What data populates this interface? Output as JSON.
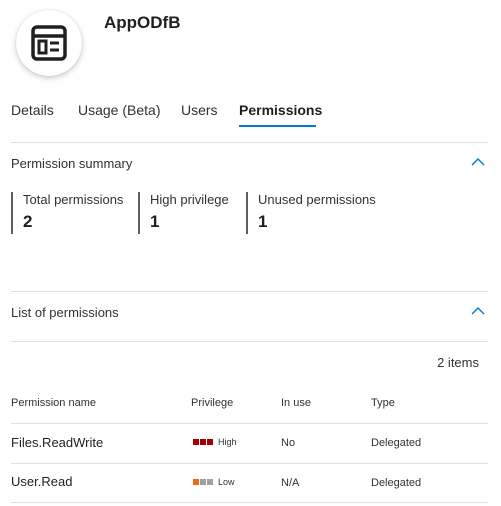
{
  "app": {
    "title": "AppODfB",
    "logo_icon": "app-window-icon"
  },
  "tabs": [
    {
      "label": "Details",
      "active": false
    },
    {
      "label": "Usage (Beta)",
      "active": false
    },
    {
      "label": "Users",
      "active": false
    },
    {
      "label": "Permissions",
      "active": true
    }
  ],
  "summary": {
    "title": "Permission summary",
    "stats": [
      {
        "label": "Total permissions",
        "value": "2"
      },
      {
        "label": "High privilege",
        "value": "1"
      },
      {
        "label": "Unused permissions",
        "value": "1"
      }
    ]
  },
  "list": {
    "title": "List of permissions",
    "count_text": "2 items",
    "columns": [
      "Permission name",
      "Privilege",
      "In use",
      "Type"
    ],
    "rows": [
      {
        "name": "Files.ReadWrite",
        "privilege": "High",
        "privilege_level": 3,
        "in_use": "No",
        "type": "Delegated"
      },
      {
        "name": "User.Read",
        "privilege": "Low",
        "privilege_level": 1,
        "in_use": "N/A",
        "type": "Delegated"
      }
    ]
  },
  "colors": {
    "accent": "#0078d4",
    "high": "#a80000",
    "low": "#ea6a1a",
    "inactive": "#a19f9d"
  }
}
